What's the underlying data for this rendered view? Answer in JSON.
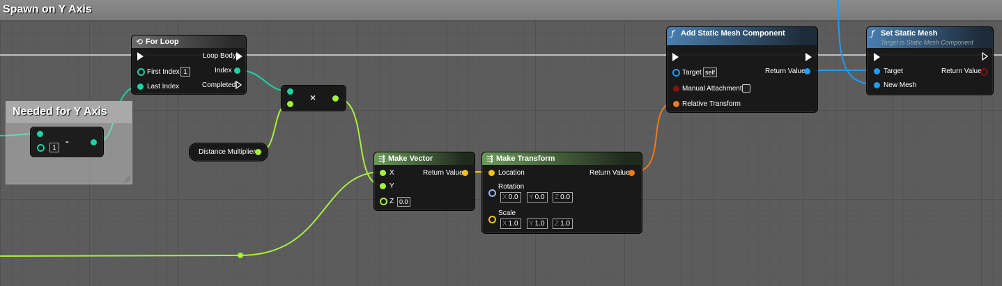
{
  "graph_title": "Spawn on Y Axis",
  "comment": {
    "title": "Needed for Y Axis"
  },
  "colors": {
    "int_pin": "#1dd3a3",
    "float_pin": "#a8f03c",
    "vector_pin": "#f6c11a",
    "transform_pin": "#f07b12",
    "object_pin": "#1f9df2",
    "rotator_pin": "#9fb3ff",
    "bool_pin": "#8a1010"
  },
  "subtract_node": {
    "op": "-",
    "value": "1"
  },
  "for_loop": {
    "title": "For Loop",
    "first_index_label": "First Index",
    "first_index_value": "1",
    "last_index_label": "Last Index",
    "loop_body_label": "Loop Body",
    "index_label": "Index",
    "completed_label": "Completed"
  },
  "multiply_node": {
    "op": "×"
  },
  "distance_multiplier": {
    "label": "Distance Multiplier"
  },
  "make_vector": {
    "title": "Make Vector",
    "x_label": "X",
    "y_label": "Y",
    "z_label": "Z",
    "z_value": "0.0",
    "return_label": "Return Value"
  },
  "make_transform": {
    "title": "Make Transform",
    "location_label": "Location",
    "rotation_label": "Rotation",
    "scale_label": "Scale",
    "return_label": "Return Value",
    "rotation": {
      "x": "0.0",
      "y": "0.0",
      "z": "0.0"
    },
    "scale": {
      "x": "1.0",
      "y": "1.0",
      "z": "1.0"
    },
    "axes": {
      "x": "X",
      "y": "Y",
      "z": "Z"
    }
  },
  "add_static_mesh": {
    "title": "Add Static Mesh Component",
    "target_label": "Target",
    "target_value": "self",
    "manual_attachment_label": "Manual Attachment",
    "relative_transform_label": "Relative Transform",
    "return_label": "Return Value"
  },
  "set_static_mesh": {
    "title": "Set Static Mesh",
    "subtitle": "Target is Static Mesh Component",
    "target_label": "Target",
    "new_mesh_label": "New Mesh",
    "return_label": "Return Value"
  }
}
